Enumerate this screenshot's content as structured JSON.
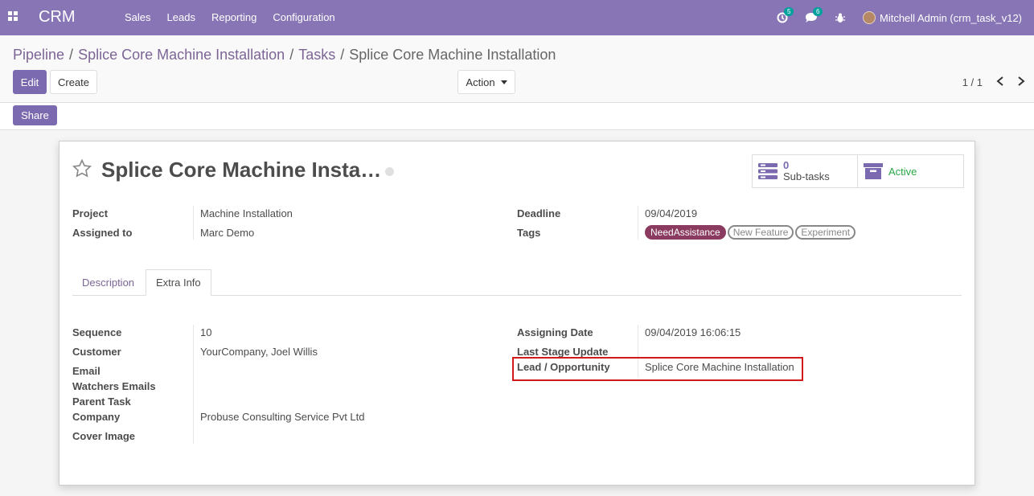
{
  "navbar": {
    "brand": "CRM",
    "menu": [
      "Sales",
      "Leads",
      "Reporting",
      "Configuration"
    ],
    "activity_count": "5",
    "message_count": "6",
    "user": "Mitchell Admin (crm_task_v12)"
  },
  "breadcrumb": {
    "items": [
      "Pipeline",
      "Splice Core Machine Installation",
      "Tasks"
    ],
    "current": "Splice Core Machine Installation"
  },
  "toolbar": {
    "edit_label": "Edit",
    "create_label": "Create",
    "action_label": "Action",
    "pager": "1 / 1",
    "share_label": "Share"
  },
  "record": {
    "title": "Splice Core Machine Insta…",
    "subtasks_count": "0",
    "subtasks_label": "Sub-tasks",
    "active_label": "Active"
  },
  "fields": {
    "project_label": "Project",
    "project_value": "Machine Installation",
    "assigned_label": "Assigned to",
    "assigned_value": "Marc Demo",
    "deadline_label": "Deadline",
    "deadline_value": "09/04/2019",
    "tags_label": "Tags",
    "tags": [
      "NeedAssistance",
      "New Feature",
      "Experiment"
    ]
  },
  "tabs": [
    "Description",
    "Extra Info"
  ],
  "extra": {
    "sequence_label": "Sequence",
    "sequence_value": "10",
    "customer_label": "Customer",
    "customer_value": "YourCompany, Joel Willis",
    "email_label": "Email",
    "watchers_label": "Watchers Emails",
    "parent_label": "Parent Task",
    "company_label": "Company",
    "company_value": "Probuse Consulting Service Pvt Ltd",
    "cover_label": "Cover Image",
    "assigning_label": "Assigning Date",
    "assigning_value": "09/04/2019 16:06:15",
    "last_stage_label": "Last Stage Update",
    "lead_label": "Lead / Opportunity",
    "lead_value": "Splice Core Machine Installation"
  },
  "colors": {
    "navbar": "#8775b5",
    "primary": "#7c6ab0",
    "link": "#7c6596",
    "tag_filled": "#8a3b5f",
    "highlight": "#d31a1a"
  }
}
